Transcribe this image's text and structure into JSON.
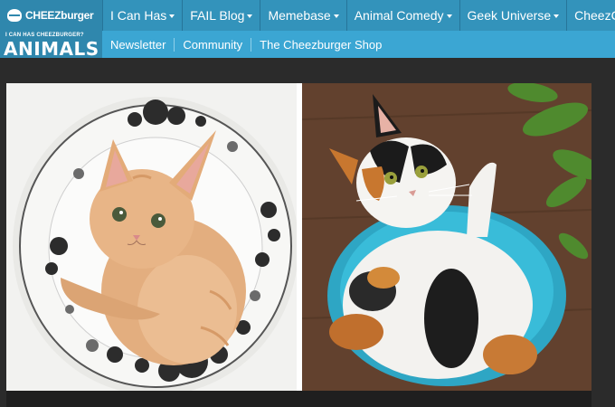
{
  "header": {
    "logo_text": "CHEEZburger",
    "nav": [
      {
        "label": "I Can Has",
        "caret": true
      },
      {
        "label": "FAIL Blog",
        "caret": true
      },
      {
        "label": "Memebase",
        "caret": true
      },
      {
        "label": "Animal Comedy",
        "caret": true
      },
      {
        "label": "Geek Universe",
        "caret": true
      },
      {
        "label": "CheezCa",
        "caret": false
      }
    ]
  },
  "subnav": {
    "brand_small": "I CAN HAS CHEEZBURGER?",
    "brand_big": "ANIMALS",
    "links": [
      "Newsletter",
      "Community",
      "The Cheezburger Shop"
    ]
  },
  "colors": {
    "topbar": "#2f87ad",
    "subbar": "#3ba6d3",
    "page_bg": "#2b2b2b"
  }
}
